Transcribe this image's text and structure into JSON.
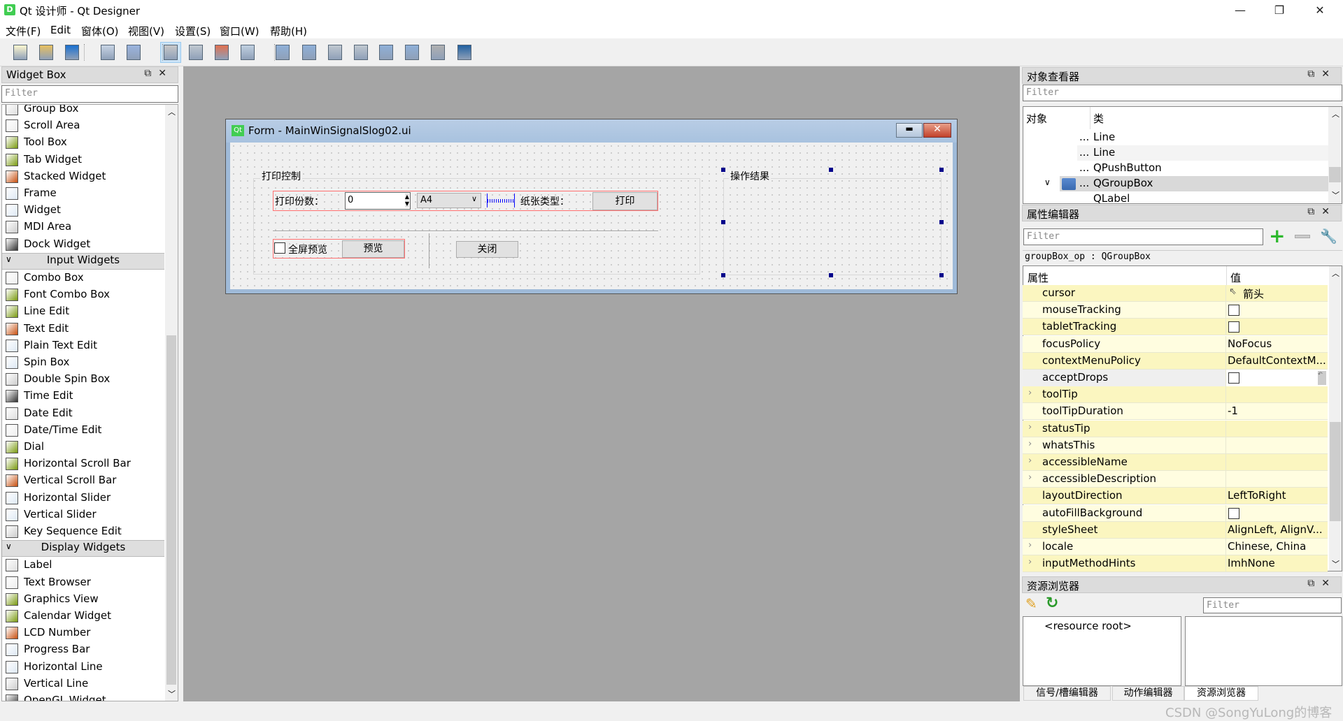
{
  "window": {
    "title": "Qt 设计师 - Qt Designer",
    "app_icon": "D",
    "minimize": "—",
    "restore": "❐",
    "close": "✕"
  },
  "menu": [
    "文件(F)",
    "Edit",
    "窗体(O)",
    "视图(V)",
    "设置(S)",
    "窗口(W)",
    "帮助(H)"
  ],
  "toolbar": [
    {
      "icon": "new-file-icon"
    },
    {
      "icon": "open-folder-icon"
    },
    {
      "icon": "save-icon"
    },
    {
      "icon": "send-to-back-icon"
    },
    {
      "icon": "bring-to-front-icon"
    },
    {
      "icon": "edit-widgets-icon",
      "active": true
    },
    {
      "icon": "edit-signals-slots-icon"
    },
    {
      "icon": "edit-buddies-icon"
    },
    {
      "icon": "edit-tab-order-icon"
    },
    {
      "icon": "layout-horizontal-icon"
    },
    {
      "icon": "layout-vertical-icon"
    },
    {
      "icon": "layout-h-splitter-icon"
    },
    {
      "icon": "layout-v-splitter-icon"
    },
    {
      "icon": "layout-grid-icon"
    },
    {
      "icon": "layout-form-icon"
    },
    {
      "icon": "break-layout-icon"
    },
    {
      "icon": "adjust-size-icon"
    }
  ],
  "widget_box": {
    "title": "Widget Box",
    "filter_placeholder": "Filter",
    "items": [
      {
        "label": "Group Box"
      },
      {
        "label": "Scroll Area"
      },
      {
        "label": "Tool Box"
      },
      {
        "label": "Tab Widget"
      },
      {
        "label": "Stacked Widget"
      },
      {
        "label": "Frame"
      },
      {
        "label": "Widget"
      },
      {
        "label": "MDI Area"
      },
      {
        "label": "Dock Widget"
      },
      {
        "label": "Input Widgets",
        "category": true
      },
      {
        "label": "Combo Box"
      },
      {
        "label": "Font Combo Box"
      },
      {
        "label": "Line Edit"
      },
      {
        "label": "Text Edit"
      },
      {
        "label": "Plain Text Edit"
      },
      {
        "label": "Spin Box"
      },
      {
        "label": "Double Spin Box"
      },
      {
        "label": "Time Edit"
      },
      {
        "label": "Date Edit"
      },
      {
        "label": "Date/Time Edit"
      },
      {
        "label": "Dial"
      },
      {
        "label": "Horizontal Scroll Bar"
      },
      {
        "label": "Vertical Scroll Bar"
      },
      {
        "label": "Horizontal Slider"
      },
      {
        "label": "Vertical Slider"
      },
      {
        "label": "Key Sequence Edit"
      },
      {
        "label": "Display Widgets",
        "category": true
      },
      {
        "label": "Label"
      },
      {
        "label": "Text Browser"
      },
      {
        "label": "Graphics View"
      },
      {
        "label": "Calendar Widget"
      },
      {
        "label": "LCD Number"
      },
      {
        "label": "Progress Bar"
      },
      {
        "label": "Horizontal Line"
      },
      {
        "label": "Vertical Line"
      },
      {
        "label": "OpenGL Widget"
      }
    ]
  },
  "form": {
    "title": "Form - MainWinSignalSlog02.ui",
    "icon": "Qt",
    "group_print": "打印控制",
    "copies_label": "打印份数：",
    "copies_value": "0",
    "paper_combo": "A4",
    "paper_type_label": "纸张类型：",
    "print_button": "打印",
    "fullscreen_label": "全屏预览",
    "fullscreen_checked": false,
    "preview_button": "预览",
    "close_button": "关闭",
    "group_result": "操作结果"
  },
  "object_inspector": {
    "title": "对象查看器",
    "filter_placeholder": "Filter",
    "col_object": "对象",
    "col_class": "类",
    "rows": [
      {
        "name": "...",
        "class": "Line"
      },
      {
        "name": "...",
        "class": "Line"
      },
      {
        "name": "...",
        "class": "QPushButton"
      },
      {
        "name": "...",
        "class": "QGroupBox",
        "selected": true
      },
      {
        "name": "",
        "class": "QLabel"
      }
    ]
  },
  "property_editor": {
    "title": "属性编辑器",
    "filter_placeholder": "Filter",
    "object_label": "groupBox_op : QGroupBox",
    "col_property": "属性",
    "col_value": "值",
    "rows": [
      {
        "name": "cursor",
        "value": "箭头",
        "icon": "arrow-cursor-icon"
      },
      {
        "name": "mouseTracking",
        "checkbox": true
      },
      {
        "name": "tabletTracking",
        "checkbox": true
      },
      {
        "name": "focusPolicy",
        "value": "NoFocus"
      },
      {
        "name": "contextMenuPolicy",
        "value": "DefaultContextM..."
      },
      {
        "name": "acceptDrops",
        "checkbox": true,
        "editing": true
      },
      {
        "name": "toolTip",
        "value": "",
        "expandable": true
      },
      {
        "name": "toolTipDuration",
        "value": "-1"
      },
      {
        "name": "statusTip",
        "value": "",
        "expandable": true
      },
      {
        "name": "whatsThis",
        "value": "",
        "expandable": true
      },
      {
        "name": "accessibleName",
        "value": "",
        "expandable": true
      },
      {
        "name": "accessibleDescription",
        "value": "",
        "expandable": true
      },
      {
        "name": "layoutDirection",
        "value": "LeftToRight"
      },
      {
        "name": "autoFillBackground",
        "checkbox": true
      },
      {
        "name": "styleSheet",
        "value": "AlignLeft, AlignV..."
      },
      {
        "name": "locale",
        "value": "Chinese, China",
        "expandable": true
      },
      {
        "name": "inputMethodHints",
        "value": "ImhNone",
        "expandable": true
      }
    ]
  },
  "resource_browser": {
    "title": "资源浏览器",
    "filter_placeholder": "Filter",
    "root": "<resource root>"
  },
  "bottom_tabs": [
    {
      "label": "信号/槽编辑器"
    },
    {
      "label": "动作编辑器"
    },
    {
      "label": "资源浏览器",
      "active": true
    }
  ],
  "watermark": "CSDN @SongYuLong的博客",
  "colors": {
    "mdi": "#a5a5a5",
    "prop_row_a": "#fbf6c0",
    "prop_row_b": "#fffde0",
    "selection": "#d9d9d9",
    "layout_red": "#ff7070",
    "handle": "#00008b"
  }
}
